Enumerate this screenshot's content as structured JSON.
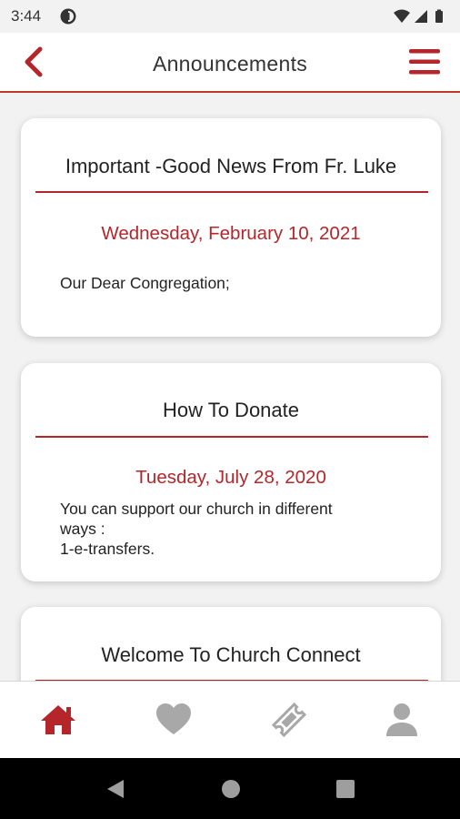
{
  "status_bar": {
    "time": "3:44"
  },
  "header": {
    "title": "Announcements"
  },
  "announcements": [
    {
      "title": "Important -Good News From Fr. Luke",
      "date": "Wednesday, February 10, 2021",
      "body": [
        "Our Dear Congregation;"
      ]
    },
    {
      "title": "How To Donate",
      "date": "Tuesday, July 28, 2020",
      "body": [
        "You can support our church in different",
        "ways :",
        "1-e-transfers."
      ]
    },
    {
      "title": "Welcome To Church Connect"
    }
  ],
  "bottom_nav": {
    "items": [
      {
        "icon": "home-icon",
        "active": true
      },
      {
        "icon": "heart-icon",
        "active": false
      },
      {
        "icon": "ticket-icon",
        "active": false
      },
      {
        "icon": "user-icon",
        "active": false
      }
    ]
  },
  "colors": {
    "accent": "#b5262b",
    "inactive_icon": "#a8a8a8",
    "background": "#f2f2f2"
  }
}
